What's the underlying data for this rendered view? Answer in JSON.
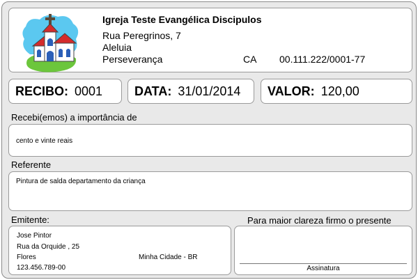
{
  "organization": {
    "name": "Igreja Teste Evangélica Discipulos",
    "street": "Rua Peregrinos, 7",
    "district": "Aleluia",
    "city": "Perseverança",
    "state": "CA",
    "document": "00.111.222/0001-77",
    "logo_icon": "church-icon"
  },
  "receipt": {
    "number_label": "RECIBO:",
    "number": "0001",
    "date_label": "DATA:",
    "date": "31/01/2014",
    "value_label": "VALOR:",
    "value": "120,00"
  },
  "amount_words": {
    "label": "Recebi(emos) a importância de",
    "text": "cento e vinte reais"
  },
  "reference": {
    "label": "Referente",
    "text": "Pintura de salda departamento da criança"
  },
  "issuer": {
    "label": "Emitente:",
    "name": "Jose Pintor",
    "street": "Rua da Orquide , 25",
    "district": "Flores",
    "city": "Minha Cidade - BR",
    "document": "123.456.789-00"
  },
  "signature": {
    "heading": "Para maior clareza firmo o presente",
    "label": "Assinatura"
  },
  "colors": {
    "background": "#e9e9e9",
    "box": "#ffffff",
    "border": "#9a9a9a"
  }
}
